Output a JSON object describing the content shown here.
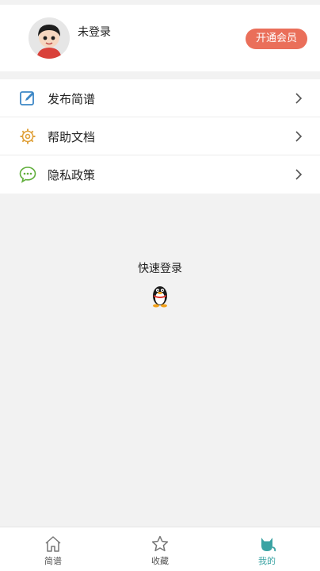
{
  "profile": {
    "username": "未登录",
    "vip_button": "开通会员",
    "avatar_icon": "cartoon-boy-avatar"
  },
  "menu": {
    "items": [
      {
        "label": "发布简谱",
        "icon": "edit-icon"
      },
      {
        "label": "帮助文档",
        "icon": "gear-icon"
      },
      {
        "label": "隐私政策",
        "icon": "chat-bubble-icon"
      }
    ]
  },
  "quick_login": {
    "title": "快速登录",
    "icon": "qq-penguin-icon"
  },
  "tabbar": {
    "tabs": [
      {
        "label": "简谱",
        "icon": "home-icon",
        "active": false
      },
      {
        "label": "收藏",
        "icon": "star-icon",
        "active": false
      },
      {
        "label": "我的",
        "icon": "cat-icon",
        "active": true
      }
    ]
  },
  "colors": {
    "accent": "#ea6f5a",
    "tab_active": "#3aa3a3",
    "background": "#f2f2f2"
  }
}
